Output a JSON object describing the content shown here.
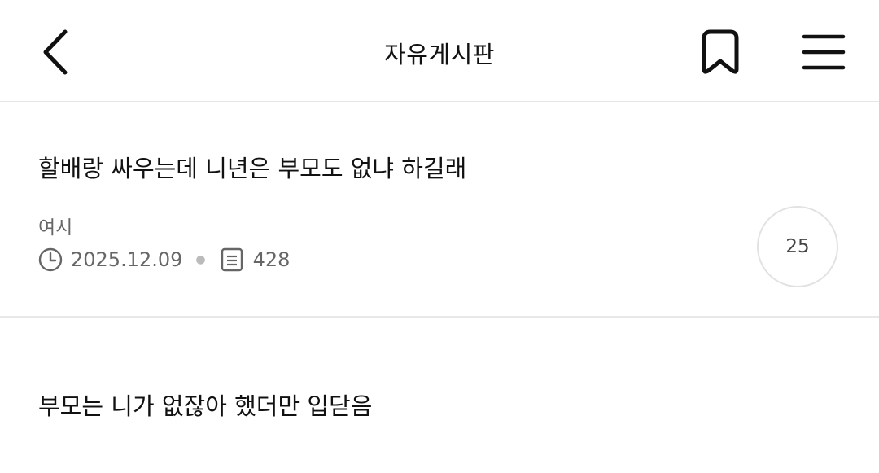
{
  "header": {
    "title": "자유게시판",
    "back_icon": "chevron-left-icon",
    "bookmark_icon": "bookmark-icon",
    "menu_icon": "hamburger-menu-icon"
  },
  "posts": [
    {
      "title": "할배랑 싸우는데 니년은 부모도 없냐 하길래",
      "author": "여시",
      "date": "2025.12.09",
      "views": "428",
      "comments": "25"
    },
    {
      "title": "부모는 니가 없잖아 했더만 입닫음"
    }
  ],
  "colors": {
    "text": "#111111",
    "meta_text": "#666666",
    "divider": "#e8e8e8",
    "comment_circle_border": "#e2e2e2"
  }
}
